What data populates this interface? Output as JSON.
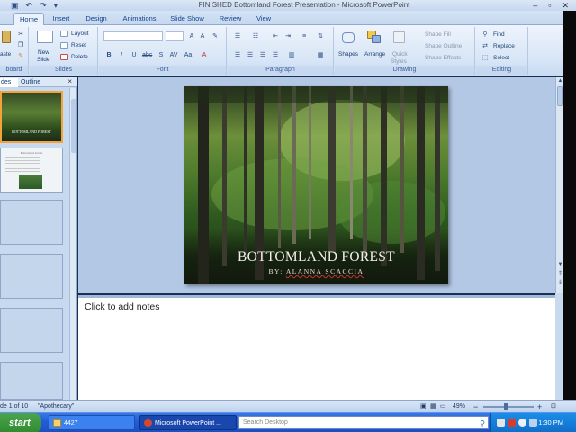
{
  "window": {
    "title": "FINISHED Bottomland Forest Presentation - Microsoft PowerPoint"
  },
  "ribbon_tabs": [
    "Home",
    "Insert",
    "Design",
    "Animations",
    "Slide Show",
    "Review",
    "View"
  ],
  "ribbon": {
    "clipboard": {
      "paste": "aste",
      "label": "board"
    },
    "slides": {
      "new_slide_1": "New",
      "new_slide_2": "Slide",
      "layout": "Layout",
      "reset": "Reset",
      "delete": "Delete",
      "label": "Slides"
    },
    "font": {
      "label": "Font"
    },
    "paragraph": {
      "label": "Paragraph"
    },
    "drawing": {
      "shapes": "Shapes",
      "arrange": "Arrange",
      "quick_1": "Quick",
      "quick_2": "Styles",
      "shape_fill": "Shape Fill",
      "shape_outline": "Shape Outline",
      "shape_effects": "Shape Effects",
      "label": "Drawing"
    },
    "editing": {
      "find": "Find",
      "replace": "Replace",
      "select": "Select",
      "label": "Editing"
    }
  },
  "left_panel": {
    "tab_slides": "des",
    "tab_outline": "Outline",
    "close": "×",
    "thumb1_title": "BOTTOMLAND FOREST",
    "thumb2_title": "Bottomland Forest"
  },
  "slide": {
    "title": "BOTTOMLAND FOREST",
    "subtitle_prefix": "BY: ",
    "subtitle_name": "ALANNA SCACCIA"
  },
  "notes": {
    "placeholder": "Click to add notes"
  },
  "statusbar": {
    "slide_of": "de 1 of 10",
    "theme": "\"Apothecary\"",
    "zoom": "49%",
    "zoom_minus": "−",
    "zoom_plus": "+"
  },
  "taskbar": {
    "start": "start",
    "folder": "4427",
    "powerpoint": "Microsoft PowerPoint ...",
    "search_placeholder": "Search Desktop",
    "clock": "1:30 PM"
  }
}
